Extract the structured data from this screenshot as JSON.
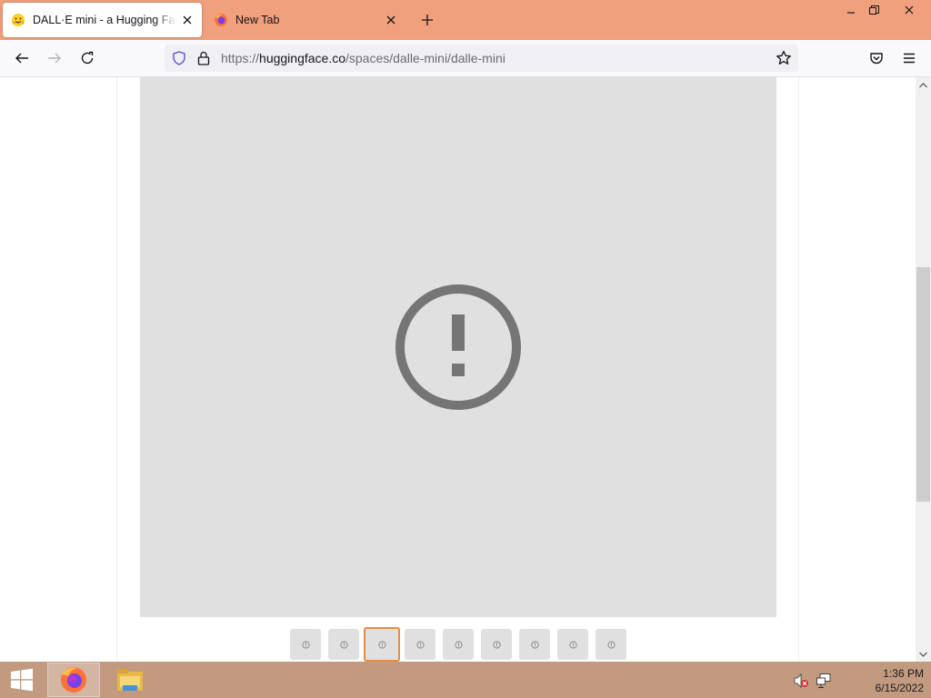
{
  "browser": {
    "tabs": [
      {
        "title": "DALL·E mini - a Hugging Face Space by dalle-mini",
        "favicon": "hugging-face-icon",
        "active": true
      },
      {
        "title": "New Tab",
        "favicon": "firefox-icon",
        "active": false
      }
    ],
    "url": {
      "scheme": "https://",
      "domain": "huggingface.co",
      "path": "/spaces/dalle-mini/dalle-mini"
    },
    "accent_color": "#f0a07c"
  },
  "gallery": {
    "main_image_state": "error-icon",
    "thumbnail_count": 9,
    "selected_index": 2,
    "selected_color": "#f08a3a"
  },
  "taskbar": {
    "apps": [
      "firefox-icon",
      "file-explorer-icon"
    ],
    "time": "1:36 PM",
    "date": "6/15/2022"
  }
}
